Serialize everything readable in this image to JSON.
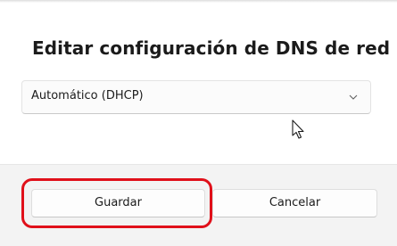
{
  "dialog": {
    "title": "Editar configuración de DNS de red"
  },
  "dns_mode": {
    "selected_value": "Automático (DHCP)"
  },
  "footer": {
    "save_label": "Guardar",
    "cancel_label": "Cancelar"
  },
  "annotation": {
    "highlight_color": "#e0101a",
    "highlight_target": "save-button"
  },
  "icons": {
    "dropdown": "chevron-down-icon",
    "cursor": "mouse-pointer-icon"
  }
}
